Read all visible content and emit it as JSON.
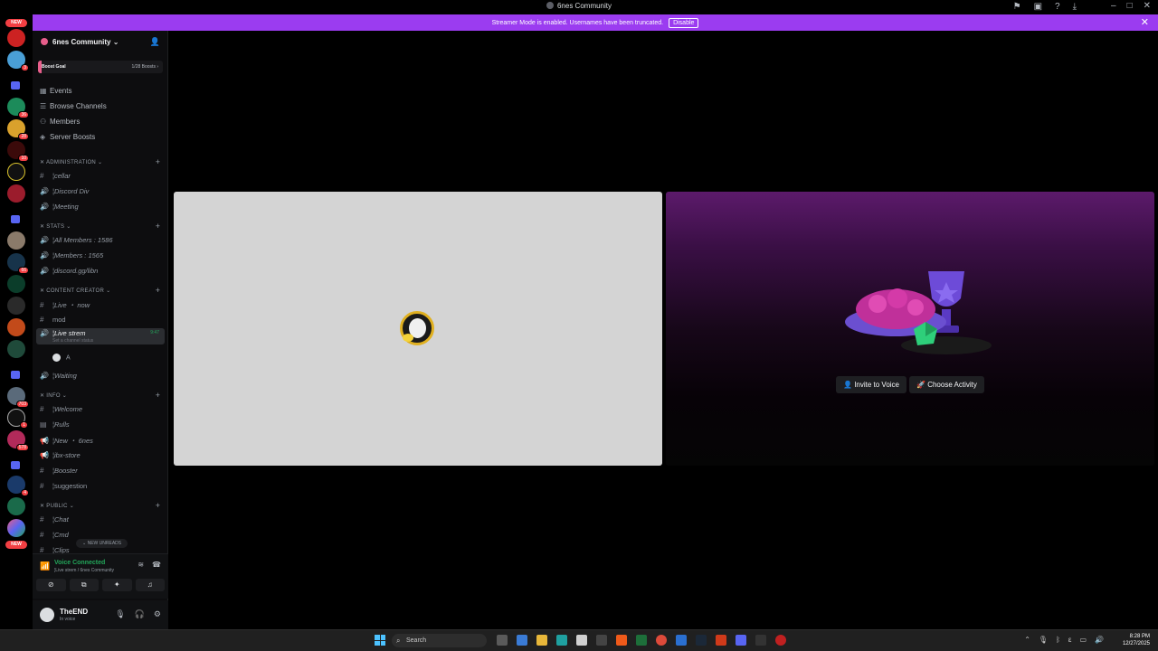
{
  "window": {
    "title": "6nes Community"
  },
  "banner": {
    "message": "Streamer Mode is enabled. Usernames have been truncated.",
    "disable_label": "Disable"
  },
  "guilds": {
    "new_label": "NEW",
    "badges": [
      "3",
      "36",
      "28",
      "10",
      "66",
      "703",
      "1",
      "578",
      "4"
    ]
  },
  "server": {
    "name": "6nes Community",
    "boost_label": "Boost Goal",
    "boost_count": "1/28 Boosts",
    "boost_progress": 0.04
  },
  "nav": [
    "Events",
    "Browse Channels",
    "Members",
    "Server Boosts"
  ],
  "categories": {
    "administration": "ADMINISTRATION",
    "stats": "STATS",
    "content_creator": "CONTENT CREATOR",
    "info": "INFO",
    "public": "PUBLIC"
  },
  "channels": {
    "cellar": "¦cellar",
    "discord_div": "¦Discord Div",
    "meeting": "¦Meeting",
    "all_members": "¦All Members : 1586",
    "members": "¦Members : 1565",
    "discord_link": "¦discord.gg/libn",
    "live_now": "¦Live ・ now",
    "mod": "mod",
    "live_strem": "¦Live strem",
    "live_strem_status": "Set a channel status",
    "live_strem_time": "9:47",
    "voice_user": "A",
    "waiting": "¦Waiting",
    "welcome": "¦Welcome",
    "rulls": "¦Rulls",
    "new_6nes": "¦New ・ 6nes",
    "ibx_store": "¦ibx-store",
    "booster": "¦Booster",
    "suggestion": "¦suggestion",
    "chat": "¦Chat",
    "cmd": "¦Cmd",
    "clips": "¦Clips"
  },
  "new_unreads": "NEW UNREADS",
  "voice": {
    "status": "Voice Connected",
    "location": "¦Live strem / 6nes Community"
  },
  "user": {
    "name": "TheEND",
    "status": "In voice"
  },
  "activity": {
    "invite_label": "Invite to Voice",
    "choose_label": "Choose Activity"
  },
  "taskbar": {
    "search_placeholder": "Search",
    "time": "8:28 PM",
    "date": "12/27/2025"
  },
  "colors": {
    "accent": "#9b3cf0",
    "voice_green": "#23a55a",
    "badge_red": "#f23f43"
  }
}
